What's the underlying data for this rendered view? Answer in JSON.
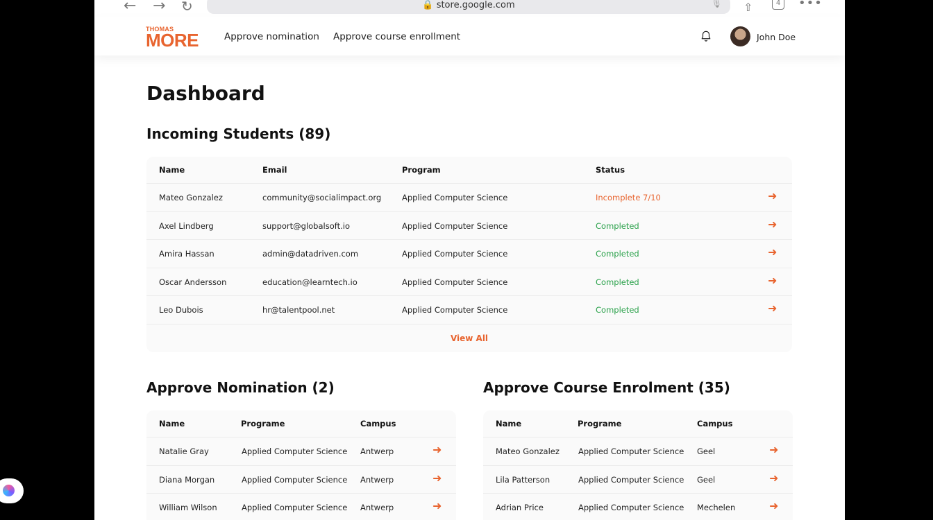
{
  "browser": {
    "url": "store.google.com",
    "tab_count": "4"
  },
  "header": {
    "logo_small": "THOMAS",
    "logo_big": "MORE",
    "nav": [
      "Approve nomination",
      "Approve course enrollment"
    ],
    "user_name": "John Doe"
  },
  "page_title": "Dashboard",
  "incoming": {
    "title": "Incoming Students (89)",
    "headers": [
      "Name",
      "Email",
      "Program",
      "Status"
    ],
    "rows": [
      {
        "name": "Mateo Gonzalez",
        "email": "community@socialimpact.org",
        "program": "Applied Computer Science",
        "status": "Incomplete 7/10",
        "state": "incomplete"
      },
      {
        "name": "Axel Lindberg",
        "email": "support@globalsoft.io",
        "program": "Applied Computer Science",
        "status": "Completed",
        "state": "completed"
      },
      {
        "name": "Amira Hassan",
        "email": "admin@datadriven.com",
        "program": "Applied Computer Science",
        "status": "Completed",
        "state": "completed"
      },
      {
        "name": "Oscar Andersson",
        "email": "education@learntech.io",
        "program": "Applied Computer Science",
        "status": "Completed",
        "state": "completed"
      },
      {
        "name": "Leo Dubois",
        "email": "hr@talentpool.net",
        "program": "Applied Computer Science",
        "status": "Completed",
        "state": "completed"
      }
    ],
    "view_all": "View All"
  },
  "nomination": {
    "title": "Approve Nomination (2)",
    "headers": [
      "Name",
      "Programe",
      "Campus"
    ],
    "rows": [
      {
        "name": "Natalie Gray",
        "program": "Applied Computer Science",
        "campus": "Antwerp"
      },
      {
        "name": "Diana Morgan",
        "program": "Applied Computer Science",
        "campus": "Antwerp"
      },
      {
        "name": "William Wilson",
        "program": "Applied Computer Science",
        "campus": "Antwerp"
      }
    ]
  },
  "enrolment": {
    "title": "Approve Course Enrolment (35)",
    "headers": [
      "Name",
      "Programe",
      "Campus"
    ],
    "rows": [
      {
        "name": "Mateo Gonzalez",
        "program": "Applied Computer Science",
        "campus": "Geel"
      },
      {
        "name": "Lila Patterson",
        "program": "Applied Computer Science",
        "campus": "Geel"
      },
      {
        "name": "Adrian Price",
        "program": "Applied Computer Science",
        "campus": "Mechelen"
      }
    ]
  },
  "colors": {
    "accent": "#e8642f",
    "completed": "#2aa14a"
  }
}
